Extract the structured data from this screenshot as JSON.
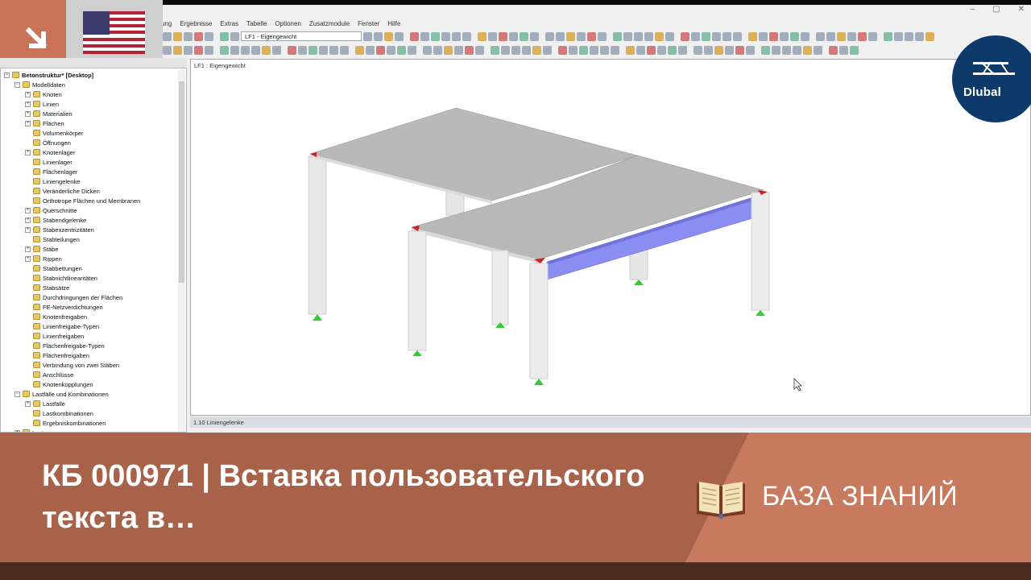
{
  "menu": [
    "ung",
    "Ergebnisse",
    "Extras",
    "Tabelle",
    "Optionen",
    "Zusatzmodule",
    "Fenster",
    "Hilfe"
  ],
  "window": {
    "minimize": "–",
    "restore": "▢",
    "close": "✕"
  },
  "toolbar": {
    "load_case": "LF1 - Eigengewicht"
  },
  "navigator": {
    "root": "Betonstruktur* [Desktop]",
    "items": [
      {
        "label": "Modelldaten",
        "level": 1,
        "exp": "−"
      },
      {
        "label": "Knoten",
        "level": 2,
        "exp": "+"
      },
      {
        "label": "Linien",
        "level": 2,
        "exp": "+"
      },
      {
        "label": "Materialien",
        "level": 2,
        "exp": "+"
      },
      {
        "label": "Flächen",
        "level": 2,
        "exp": "+"
      },
      {
        "label": "Volumenkörper",
        "level": 2,
        "exp": ""
      },
      {
        "label": "Öffnungen",
        "level": 2,
        "exp": ""
      },
      {
        "label": "Knotenlager",
        "level": 2,
        "exp": "+"
      },
      {
        "label": "Linienlager",
        "level": 2,
        "exp": ""
      },
      {
        "label": "Flächenlager",
        "level": 2,
        "exp": ""
      },
      {
        "label": "Liniengelenke",
        "level": 2,
        "exp": ""
      },
      {
        "label": "Veränderliche Dicken",
        "level": 2,
        "exp": ""
      },
      {
        "label": "Orthotrope Flächen und Membranen",
        "level": 2,
        "exp": ""
      },
      {
        "label": "Querschnitte",
        "level": 2,
        "exp": "+"
      },
      {
        "label": "Stabendgelenke",
        "level": 2,
        "exp": "+"
      },
      {
        "label": "Stabexzentrizitäten",
        "level": 2,
        "exp": "+"
      },
      {
        "label": "Stabteilungen",
        "level": 2,
        "exp": ""
      },
      {
        "label": "Stäbe",
        "level": 2,
        "exp": "+"
      },
      {
        "label": "Rippen",
        "level": 2,
        "exp": "+"
      },
      {
        "label": "Stabbettungen",
        "level": 2,
        "exp": ""
      },
      {
        "label": "Stabnichtlinearitäten",
        "level": 2,
        "exp": ""
      },
      {
        "label": "Stabsätze",
        "level": 2,
        "exp": ""
      },
      {
        "label": "Durchdringungen der Flächen",
        "level": 2,
        "exp": ""
      },
      {
        "label": "FE-Netzverdichtungen",
        "level": 2,
        "exp": ""
      },
      {
        "label": "Knotenfreigaben",
        "level": 2,
        "exp": ""
      },
      {
        "label": "Linienfreigabe-Typen",
        "level": 2,
        "exp": ""
      },
      {
        "label": "Linienfreigaben",
        "level": 2,
        "exp": ""
      },
      {
        "label": "Flächenfreigabe-Typen",
        "level": 2,
        "exp": ""
      },
      {
        "label": "Flächenfreigaben",
        "level": 2,
        "exp": ""
      },
      {
        "label": "Verbindung von zwei Stäben",
        "level": 2,
        "exp": ""
      },
      {
        "label": "Anschlüsse",
        "level": 2,
        "exp": ""
      },
      {
        "label": "Knotenkopplungen",
        "level": 2,
        "exp": ""
      },
      {
        "label": "Lastfälle und Kombinationen",
        "level": 1,
        "exp": "−"
      },
      {
        "label": "Lastfälle",
        "level": 2,
        "exp": "+"
      },
      {
        "label": "Lastkombinationen",
        "level": 2,
        "exp": ""
      },
      {
        "label": "Ergebniskombinationen",
        "level": 2,
        "exp": ""
      },
      {
        "label": "Lasten",
        "level": 1,
        "exp": "+"
      }
    ]
  },
  "canvas": {
    "label": "LF1 : Eigengewicht"
  },
  "panel": {
    "title": "1.10 Liniengelenke"
  },
  "brand": {
    "name": "Dlubal",
    "color": "#0e3a6b"
  },
  "banner": {
    "title": "КБ 000971 | Вставка пользовательского текста в…",
    "section": "БАЗА ЗНАНИЙ"
  },
  "colors": {
    "banner": "#c87a5e",
    "banner_dark": "#a8624a",
    "footer": "#4b2a1f",
    "arrow_tile": "#c97358"
  }
}
